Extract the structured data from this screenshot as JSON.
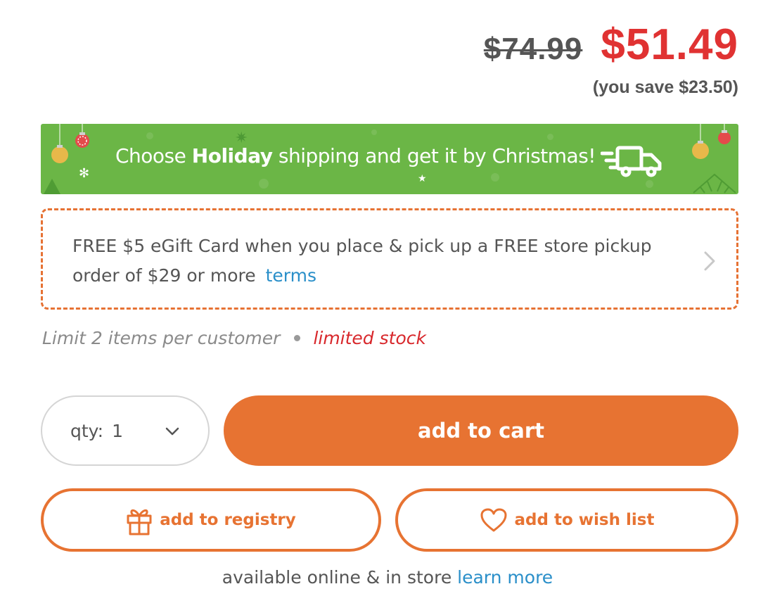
{
  "price": {
    "original": "$74.99",
    "sale": "$51.49",
    "savings": "(you save $23.50)"
  },
  "holiday_banner": {
    "prefix": "Choose ",
    "highlight": "Holiday",
    "suffix": " shipping and get it by Christmas!",
    "icon": "delivery-truck-icon"
  },
  "promo": {
    "text": "FREE $5 eGift Card when you place & pick up a FREE store pickup order of $29 or more",
    "terms_label": "terms",
    "icon": "chevron-right-icon"
  },
  "limit": {
    "text": "Limit 2 items per customer",
    "stock": "limited stock"
  },
  "qty": {
    "label": "qty:",
    "value": "1",
    "icon": "chevron-down-icon"
  },
  "buttons": {
    "add_to_cart": "add to cart",
    "add_to_registry": "add to registry",
    "add_to_wish_list": "add to wish list"
  },
  "availability": {
    "text": "available online & in store ",
    "link": "learn more"
  },
  "colors": {
    "sale_red": "#e03232",
    "accent_orange": "#e77332",
    "banner_green": "#6bb646",
    "link_blue": "#2a8fc9",
    "stock_red": "#d8282c"
  }
}
